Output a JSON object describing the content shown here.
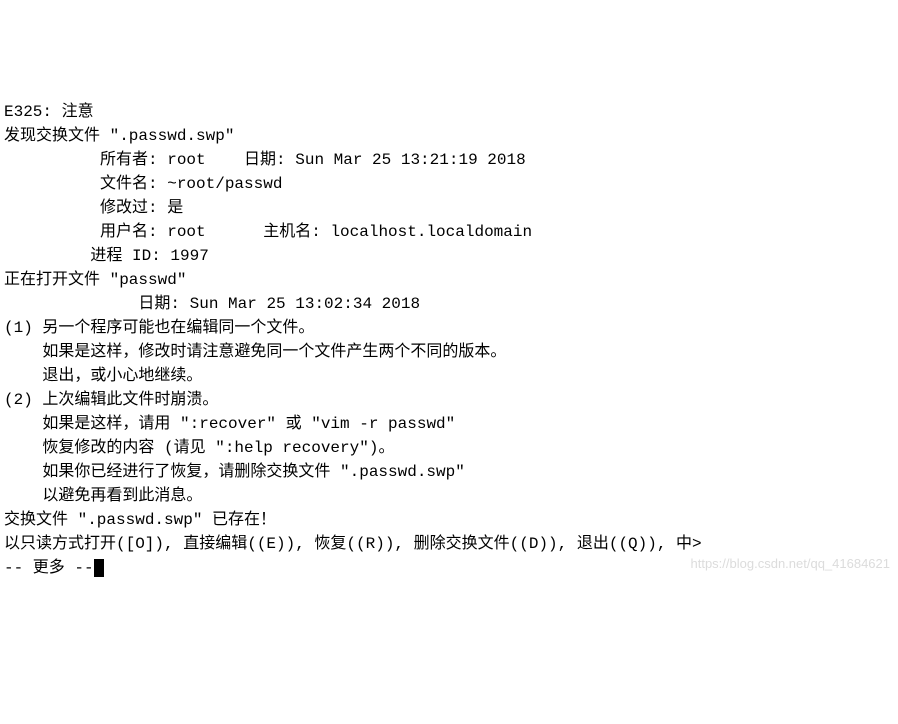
{
  "terminal": {
    "line1": "E325: 注意",
    "line2": "发现交换文件 \".passwd.swp\"",
    "line3": "          所有者: root    日期: Sun Mar 25 13:21:19 2018",
    "line4": "          文件名: ~root/passwd",
    "line5": "          修改过: 是",
    "line6": "          用户名: root      主机名: localhost.localdomain",
    "line7": "         进程 ID: 1997",
    "line8": "正在打开文件 \"passwd\"",
    "line9": "              日期: Sun Mar 25 13:02:34 2018",
    "line10": "",
    "line11": "(1) 另一个程序可能也在编辑同一个文件。",
    "line12": "    如果是这样，修改时请注意避免同一个文件产生两个不同的版本。",
    "line13": "",
    "line14": "    退出，或小心地继续。",
    "line15": "",
    "line16": "(2) 上次编辑此文件时崩溃。",
    "line17": "    如果是这样，请用 \":recover\" 或 \"vim -r passwd\"",
    "line18": "    恢复修改的内容 (请见 \":help recovery\")。",
    "line19": "    如果你已经进行了恢复，请删除交换文件 \".passwd.swp\"",
    "line20": "    以避免再看到此消息。",
    "line21": "",
    "line22": "交换文件 \".passwd.swp\" 已存在！",
    "line23": "以只读方式打开([O]), 直接编辑((E)), 恢复((R)), 删除交换文件((D)), 退出((Q)), 中>",
    "line24": "-- 更多 --"
  },
  "watermark": "https://blog.csdn.net/qq_41684621"
}
